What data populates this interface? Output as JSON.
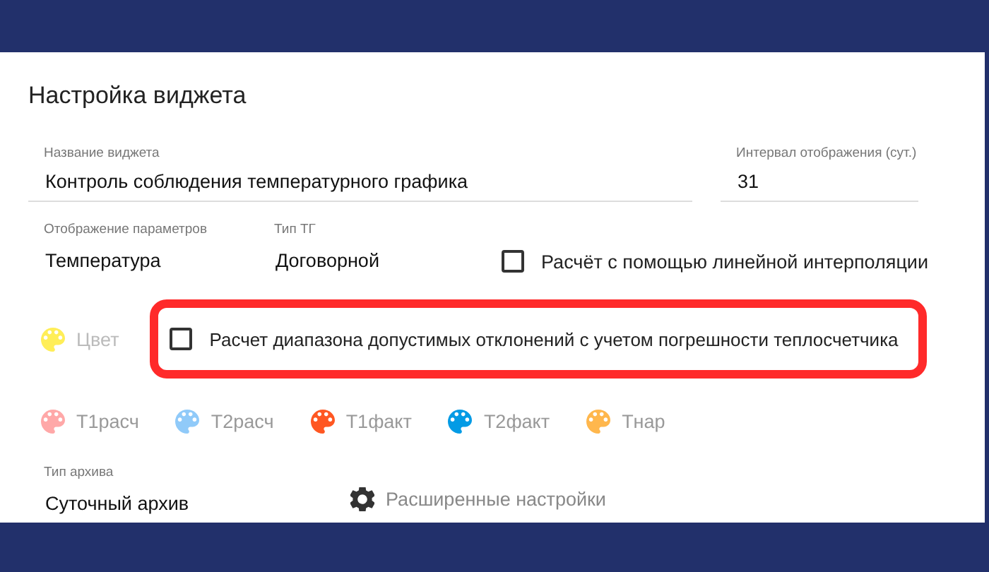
{
  "dialog": {
    "title": "Настройка виджета",
    "fields": [
      {
        "label": "Название виджета",
        "value": "Контроль соблюдения температурного графика"
      },
      {
        "label": "Интервал отображения (сут.)",
        "value": "31"
      }
    ],
    "selects": [
      {
        "label": "Отображение параметров",
        "value": "Температура"
      },
      {
        "label": "Тип ТГ",
        "value": "Договорной"
      }
    ],
    "checkboxes": [
      {
        "label": "Расчёт с помощью линейной интерполяции",
        "checked": false,
        "highlighted": false
      },
      {
        "label": "Расчет диапазона допустимых отклонений с учетом погрешности теплосчетчика",
        "checked": false,
        "highlighted": true
      }
    ],
    "base_color": {
      "label": "Цвет",
      "color": "#ffee58",
      "disabled": true
    },
    "series_colors": [
      {
        "label": "T1расч",
        "color": "#ffa8a8"
      },
      {
        "label": "T2расч",
        "color": "#90caf9"
      },
      {
        "label": "T1факт",
        "color": "#ff5722"
      },
      {
        "label": "T2факт",
        "color": "#039be5"
      },
      {
        "label": "Tнар",
        "color": "#ffb74d"
      }
    ],
    "archive": {
      "label": "Тип архива",
      "value": "Суточный архив"
    },
    "advanced_link": "Расширенные настройки"
  }
}
